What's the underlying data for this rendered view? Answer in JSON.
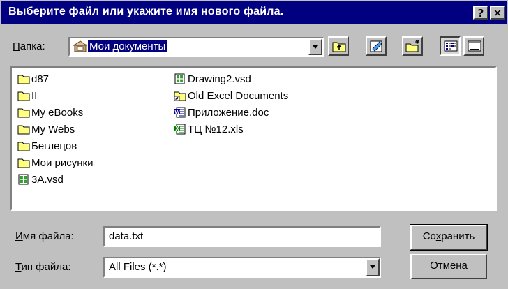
{
  "window": {
    "title": "Выберите файл или укажите имя нового файла.",
    "help_label": "?",
    "close_label": "✕"
  },
  "folder": {
    "label_u": "П",
    "label_rest": "апка:",
    "value": "Мои документы"
  },
  "toolbar": {
    "icons": [
      "up-one-level-icon",
      "favorites-icon",
      "create-new-folder-icon",
      "list-view-icon",
      "details-view-icon"
    ]
  },
  "files": [
    {
      "name": "d87",
      "icon": "folder-icon"
    },
    {
      "name": "II",
      "icon": "folder-icon"
    },
    {
      "name": "My eBooks",
      "icon": "folder-icon"
    },
    {
      "name": "My Webs",
      "icon": "folder-icon"
    },
    {
      "name": "Беглецов",
      "icon": "folder-icon"
    },
    {
      "name": "Мои рисунки",
      "icon": "folder-icon"
    },
    {
      "name": "3A.vsd",
      "icon": "visio-file-icon"
    },
    {
      "name": "Drawing2.vsd",
      "icon": "visio-file-icon"
    },
    {
      "name": "Old Excel Documents",
      "icon": "shortcut-folder-icon"
    },
    {
      "name": "Приложение.doc",
      "icon": "word-file-icon"
    },
    {
      "name": "ТЦ №12.xls",
      "icon": "excel-file-icon"
    }
  ],
  "filename": {
    "label_u": "И",
    "label_rest": "мя файла:",
    "value": "data.txt"
  },
  "filetype": {
    "label_u": "Т",
    "label_rest": "ип файла:",
    "value": "All Files (*.*)"
  },
  "buttons": {
    "save_a": "Со",
    "save_u": "х",
    "save_b": "ранить",
    "cancel": "Отмена"
  }
}
